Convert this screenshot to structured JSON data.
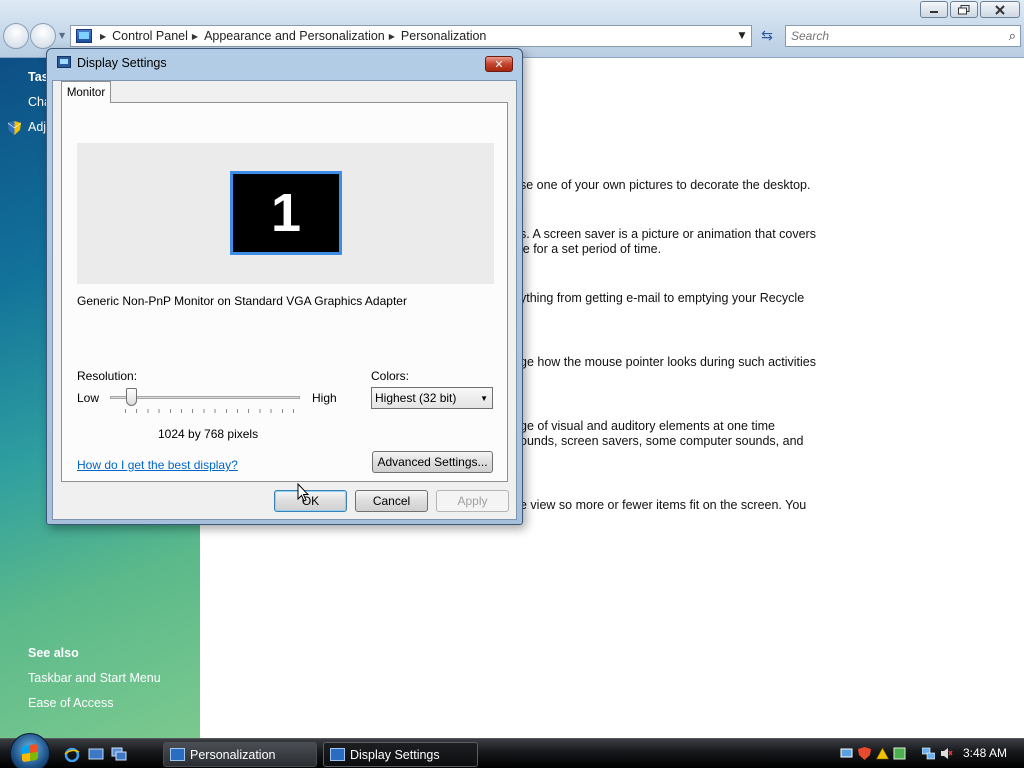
{
  "explorer": {
    "breadcrumbs": [
      "Control Panel",
      "Appearance and Personalization",
      "Personalization"
    ],
    "search_placeholder": "Search"
  },
  "left_pane": {
    "tasks_partial": [
      "Tas",
      "Cha",
      "Adj"
    ],
    "see_also_heading": "See also",
    "see_also_links": [
      "Taskbar and Start Menu",
      "Ease of Access"
    ]
  },
  "main": {
    "snippets": [
      "se one of your own pictures to decorate the desktop.",
      "s. A screen saver is a picture or animation that covers",
      "le for a set period of time.",
      "ything from getting e-mail to emptying your Recycle",
      "ge how the mouse pointer looks during such activities",
      "ge of visual and auditory elements at one time",
      "ounds, screen savers, some computer sounds, and",
      "e view so more or fewer items fit on the screen. You"
    ]
  },
  "dialog": {
    "title": "Display Settings",
    "close_glyph": "✕",
    "tab": "Monitor",
    "monitor_number": "1",
    "device_name": "Generic Non-PnP Monitor on Standard VGA Graphics Adapter",
    "resolution_label": "Resolution:",
    "low_label": "Low",
    "high_label": "High",
    "resolution_value": "1024 by 768 pixels",
    "resolution_slider_position": 0.09,
    "colors_label": "Colors:",
    "colors_value": "Highest (32 bit)",
    "help_link": "How do I get the best display?",
    "advanced_button": "Advanced Settings...",
    "ok_button": "OK",
    "cancel_button": "Cancel",
    "apply_button": "Apply"
  },
  "taskbar": {
    "tasks": [
      "Personalization",
      "Display Settings"
    ],
    "active_task": "Display Settings",
    "clock": "3:48 AM"
  },
  "colors": {
    "accent_link": "#0066cc",
    "monitor_highlight": "#3d8de6"
  }
}
